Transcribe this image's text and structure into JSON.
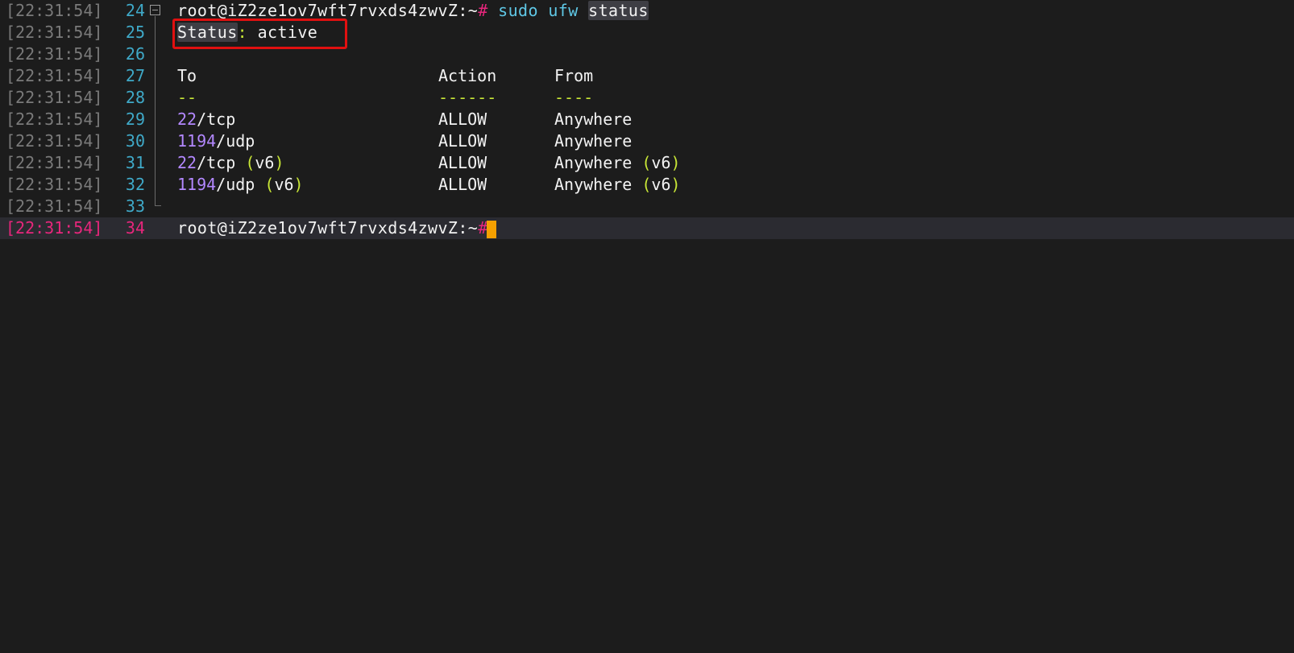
{
  "terminal": {
    "timestamp": "[22:31:54]",
    "prompt": "root@iZ2ze1ov7wft7rvxds4zwvZ:~",
    "hash": "#",
    "command": {
      "sudo": "sudo",
      "ufw": "ufw",
      "status": "status"
    },
    "status_line": {
      "label": "Status",
      "colon": ":",
      "value": "active"
    },
    "table": {
      "headers": {
        "to": "To",
        "action": "Action",
        "from": "From"
      },
      "separators": {
        "to": "--",
        "action": "------",
        "from": "----"
      },
      "rows": [
        {
          "port": "22",
          "proto": "/tcp",
          "v6": "",
          "action": "ALLOW",
          "from": "Anywhere",
          "from_v6": ""
        },
        {
          "port": "1194",
          "proto": "/udp",
          "v6": "",
          "action": "ALLOW",
          "from": "Anywhere",
          "from_v6": ""
        },
        {
          "port": "22",
          "proto": "/tcp ",
          "v6": "v6",
          "action": "ALLOW",
          "from": "Anywhere ",
          "from_v6": "v6"
        },
        {
          "port": "1194",
          "proto": "/udp ",
          "v6": "v6",
          "action": "ALLOW",
          "from": "Anywhere ",
          "from_v6": "v6"
        }
      ]
    },
    "line_numbers": [
      "24",
      "25",
      "26",
      "27",
      "28",
      "29",
      "30",
      "31",
      "32",
      "33",
      "34"
    ]
  },
  "colors": {
    "background": "#1c1c1c",
    "timestamp": "#7a7a7a",
    "line_number": "#3fa9c8",
    "current_line": "#e8267c",
    "command": "#5fc8e6",
    "port": "#b388ff",
    "accent_green": "#c8e636",
    "cursor": "#f5a000",
    "highlight_box": "#e01010"
  }
}
